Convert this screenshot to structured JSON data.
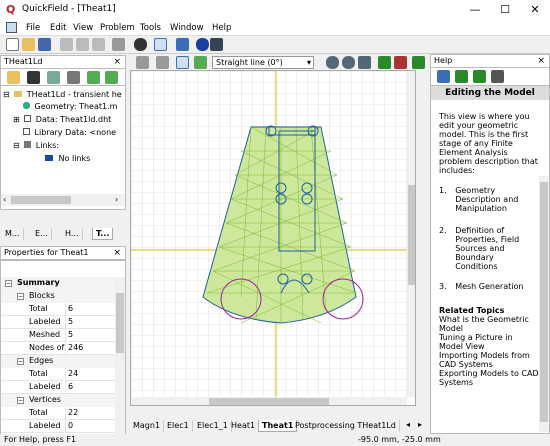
{
  "app": {
    "title": "QuickField - [Theat1]",
    "logo_letter": "Q",
    "accent": "#0078d7"
  },
  "window_controls": {
    "minimize": "—",
    "maximize": "☐",
    "close": "✕"
  },
  "menu": [
    "File",
    "Edit",
    "View",
    "Problem",
    "Tools",
    "Window",
    "Help"
  ],
  "toolbar2": {
    "selection_mode": "Straight line (0°)"
  },
  "explorer": {
    "title": "THeat1Ld",
    "close": "×",
    "tree": [
      {
        "label": "THeat1Ld - transient he",
        "indent": 0,
        "expander": "⊟"
      },
      {
        "label": "Geometry: Theat1.m",
        "indent": 1,
        "expander": ""
      },
      {
        "label": "Data: Theat1ld.dht",
        "indent": 1,
        "expander": "⊞"
      },
      {
        "label": "Library Data: <none",
        "indent": 1,
        "expander": ""
      },
      {
        "label": "Links:",
        "indent": 1,
        "expander": "⊟"
      },
      {
        "label": "No links",
        "indent": 2,
        "expander": ""
      }
    ],
    "bottom_tabs": [
      "M...",
      "E...",
      "H...",
      "T..."
    ]
  },
  "properties": {
    "title": "Properties for Theat1",
    "close": "×",
    "summary_label": "Summary",
    "groups": [
      {
        "name": "Blocks",
        "rows": [
          [
            "Total",
            "6"
          ],
          [
            "Labeled",
            "5"
          ],
          [
            "Meshed",
            "5"
          ],
          [
            "Nodes of",
            "246"
          ]
        ]
      },
      {
        "name": "Edges",
        "rows": [
          [
            "Total",
            "24"
          ],
          [
            "Labeled",
            "6"
          ]
        ]
      },
      {
        "name": "Vertices",
        "rows": [
          [
            "Total",
            "22"
          ],
          [
            "Labeled",
            "0"
          ]
        ]
      }
    ]
  },
  "help": {
    "title": "Help",
    "close": "×",
    "heading": "Editing the Model",
    "intro": "This view is where you edit your geometric model. This is the first stage of any Finite Element Analysis problem description that includes:",
    "items": [
      {
        "num": "1.",
        "text": "Geometry Description and Manipulation"
      },
      {
        "num": "2.",
        "text": "Definition of Properties, Field Sources and Boundary Conditions"
      },
      {
        "num": "3.",
        "text": "Mesh Generation"
      }
    ],
    "related_heading": "Related Topics",
    "related": [
      "What is the Geometric Model",
      "Tuning a Picture in Model View",
      "Importing Models from CAD Systems",
      "Exporting Models to CAD Systems"
    ]
  },
  "doc_tabs": [
    "Magn1",
    "Elec1",
    "Elec1_1",
    "Heat1",
    "Theat1",
    "Postprocessing THeat1Ld"
  ],
  "active_tab": "Theat1",
  "status": {
    "left": "For Help, press F1",
    "coords": "-95.0 mm, -25.0 mm"
  }
}
